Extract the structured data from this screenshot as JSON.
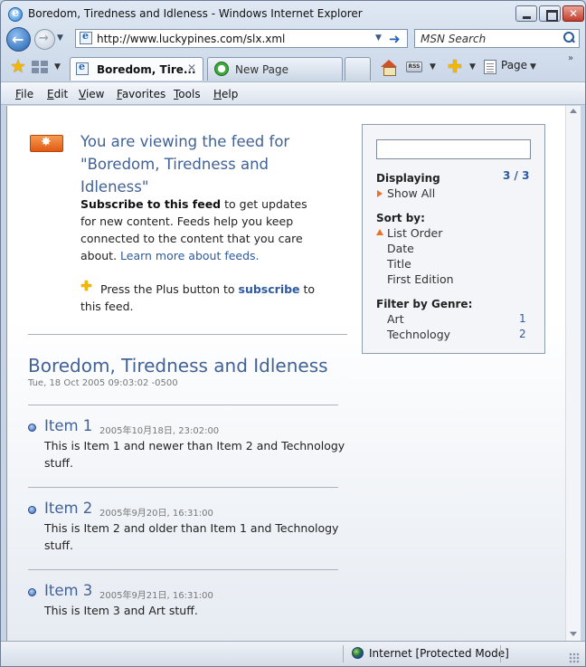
{
  "window": {
    "title": "Boredom, Tiredness and Idleness - Windows Internet Explorer"
  },
  "address": {
    "url": "http://www.luckypines.com/slx.xml"
  },
  "search": {
    "placeholder": "MSN Search"
  },
  "tabs": [
    {
      "label": "Boredom, Tire...",
      "active": true
    },
    {
      "label": "New Page",
      "active": false
    }
  ],
  "toolbar": {
    "page_label": "Page",
    "feeds_icon_text": "RSS"
  },
  "menu": [
    {
      "label": "File",
      "key": "F",
      "rest": "ile"
    },
    {
      "label": "Edit",
      "key": "E",
      "rest": "dit"
    },
    {
      "label": "View",
      "key": "V",
      "rest": "iew"
    },
    {
      "label": "Favorites",
      "key": "F",
      "rest": "avorites"
    },
    {
      "label": "Tools",
      "key": "T",
      "rest": "ools"
    },
    {
      "label": "Help",
      "key": "H",
      "rest": "elp"
    }
  ],
  "banner": {
    "heading": "You are viewing the feed for \"Boredom, Tiredness and Idleness\"",
    "subscribe_bold": "Subscribe to this feed",
    "subscribe_rest": " to get updates for new content. Feeds help you keep connected to the content that you care about. ",
    "learn_more": "Learn more about feeds.",
    "plus_text": "Press the Plus button to ",
    "plus_link": "subscribe",
    "plus_tail": " to this feed."
  },
  "feed": {
    "title": "Boredom, Tiredness and Idleness",
    "date": "Tue, 18 Oct 2005 09:03:02 -0500",
    "items": [
      {
        "title": "Item 1",
        "date": "2005年10月18日, 23:02:00",
        "description": "This is Item 1 and newer than Item 2 and Technology stuff."
      },
      {
        "title": "Item 2",
        "date": "2005年9月20日, 16:31:00",
        "description": "This is Item 2 and older than Item 1 and Technology stuff."
      },
      {
        "title": "Item 3",
        "date": "2005年9月21日, 16:31:00",
        "description": "This is Item 3 and Art stuff."
      }
    ]
  },
  "sidebar": {
    "search_value": "",
    "displaying_label": "Displaying",
    "displaying_count": "3 / 3",
    "show_all": "Show All",
    "sort_label": "Sort by:",
    "sort_options": [
      "List Order",
      "Date",
      "Title",
      "First Edition"
    ],
    "filter_label": "Filter by Genre:",
    "genres": [
      {
        "name": "Art",
        "count": "1"
      },
      {
        "name": "Technology",
        "count": "2"
      }
    ]
  },
  "status": {
    "zone": "Internet | Protected Mode: On",
    "zone_text": "Internet [Protected Mode]"
  }
}
